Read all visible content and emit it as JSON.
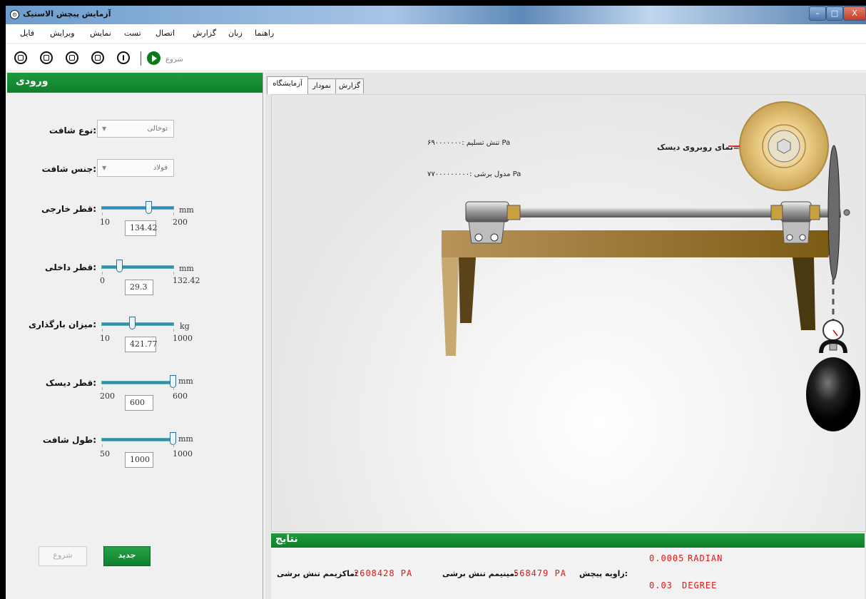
{
  "window": {
    "title": "آزمایش پیچش الاستیک",
    "controls": {
      "minimize": "–",
      "maximize": "□",
      "close": "X"
    }
  },
  "menu": {
    "items": [
      "فایل",
      "ویرایش",
      "نمایش",
      "تست",
      "اتصال",
      "گزارش",
      "زبان",
      "راهنما"
    ]
  },
  "toolbar": {
    "buttons": [
      "new-icon",
      "open-icon",
      "save-icon",
      "print-icon",
      "info-icon"
    ],
    "start_label": "شروع"
  },
  "input_panel": {
    "title": "ورودی",
    "shaft_type": {
      "label": ":نوع شافت",
      "value": "توخالی"
    },
    "shaft_material": {
      "label": ":جنس شافت",
      "value": "فولاد"
    },
    "outer_diameter": {
      "label": ":قطر خارجی",
      "min": "10",
      "max": "200",
      "value": "134.42",
      "unit": "mm",
      "level": 0.65
    },
    "inner_diameter": {
      "label": ":قطر داخلی",
      "min": "0",
      "max": "132.42",
      "value": "29.3",
      "unit": "mm",
      "level": 0.22
    },
    "load": {
      "label": ":میزان بارگذاری",
      "min": "10",
      "max": "1000",
      "value": "421.77",
      "unit": "kg",
      "level": 0.41
    },
    "disk_diameter": {
      "label": ":قطر دیسک",
      "min": "200",
      "max": "600",
      "value": "600",
      "unit": "mm",
      "level": 1.0
    },
    "shaft_length": {
      "label": ":طول شافت",
      "min": "50",
      "max": "1000",
      "value": "1000",
      "unit": "mm",
      "level": 1.0
    },
    "start_button": "شروع",
    "new_button": "جدید"
  },
  "tabs": [
    "آزمایشگاه",
    "نمودار",
    "گزارش"
  ],
  "lab": {
    "yield_stress": "Pa تنش تسلیم :۶۹۰۰۰۰۰۰۰",
    "shear_modulus": "Pa مدول برشی :۷۷۰۰۰۰۰۰۰۰۰",
    "disk_front_view": "<=نمای روبروی دیسک"
  },
  "results": {
    "title": "نتایج",
    "max_shear_label": ":ماکزیمم تنش برشی",
    "max_shear_value": "2608428 PA",
    "min_shear_label": ":مینیمم تنش برشی",
    "min_shear_value": "568479 PA",
    "twist_angle_label": ":زاویه پیچش",
    "radian_value": "0.0005",
    "radian_unit": "RADIAN",
    "degree_value": "0.03",
    "degree_unit": "DEGREE"
  }
}
